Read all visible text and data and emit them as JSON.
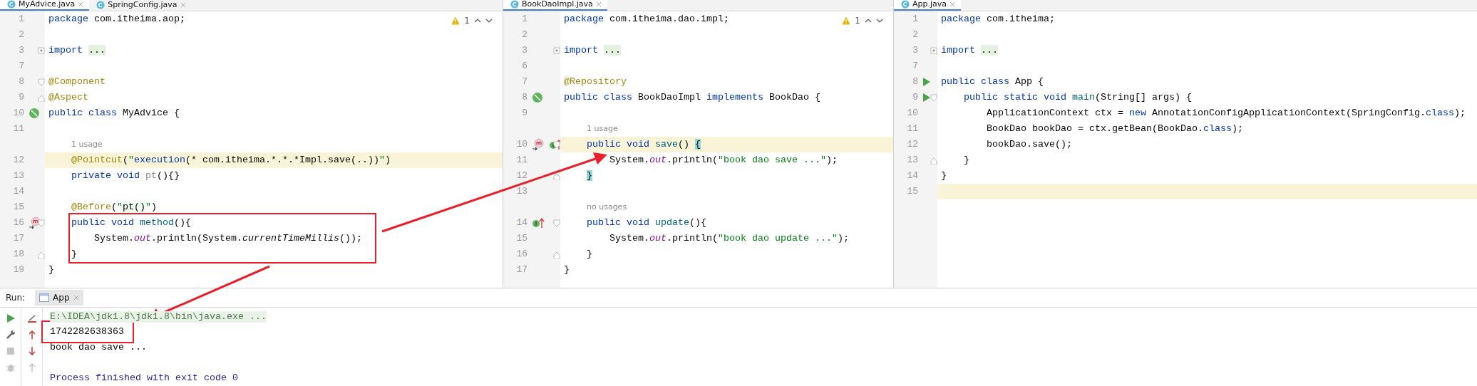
{
  "editors": [
    {
      "tabs": [
        {
          "label": "MyAdvice.java",
          "selected": true
        },
        {
          "label": "SpringConfig.java",
          "selected": false
        }
      ],
      "warning_count": "1",
      "lines": [
        {
          "kind": "code",
          "number": "1",
          "current": false,
          "tokens": [
            {
              "text": "package",
              "kind": "kw"
            },
            {
              "text": " com.itheima.aop;",
              "kind": "plain"
            }
          ]
        },
        {
          "kind": "code",
          "number": "2",
          "current": false
        },
        {
          "kind": "code",
          "number": "3",
          "current": false,
          "markers": [
            {
              "kind": "folded"
            }
          ],
          "tokens": [
            {
              "text": "import",
              "kind": "kw"
            },
            {
              "text": " ...",
              "kind": "folded"
            }
          ]
        },
        {
          "kind": "code",
          "number": "7",
          "current": false
        },
        {
          "kind": "code",
          "number": "8",
          "current": false,
          "markers": [
            {
              "kind": "foldstart"
            }
          ],
          "tokens": [
            {
              "text": "@Component",
              "kind": "ann"
            }
          ]
        },
        {
          "kind": "code",
          "number": "9",
          "current": false,
          "markers": [
            {
              "kind": "foldend"
            }
          ],
          "tokens": [
            {
              "text": "@Aspect",
              "kind": "ann"
            }
          ]
        },
        {
          "kind": "code",
          "number": "10",
          "current": false,
          "markers": [
            {
              "kind": "bean"
            }
          ],
          "tokens": [
            {
              "text": "public class",
              "kind": "kw"
            },
            {
              "text": " MyAdvice {",
              "kind": "plain"
            }
          ]
        },
        {
          "kind": "code",
          "number": "11",
          "current": false
        },
        {
          "kind": "hint",
          "text": "1 usage"
        },
        {
          "kind": "code",
          "number": "12",
          "current": true,
          "tokens": [
            {
              "text": "    @Pointcut",
              "kind": "ann"
            },
            {
              "text": "(",
              "kind": "plain"
            },
            {
              "text": "\"",
              "kind": "str"
            },
            {
              "text": "execution",
              "kind": "kw"
            },
            {
              "text": "(* com.itheima.*.*.*Impl.save(..))",
              "kind": "plain"
            },
            {
              "text": "\"",
              "kind": "str"
            },
            {
              "text": ")",
              "kind": "plain"
            }
          ]
        },
        {
          "kind": "code",
          "number": "13",
          "current": false,
          "tokens": [
            {
              "text": "    private void",
              "kind": "kw"
            },
            {
              "text": " pt",
              "kind": "unused"
            },
            {
              "text": "(){}",
              "kind": "plain"
            }
          ]
        },
        {
          "kind": "code",
          "number": "14",
          "current": false
        },
        {
          "kind": "code",
          "number": "15",
          "current": false,
          "tokens": [
            {
              "text": "    @Before",
              "kind": "ann"
            },
            {
              "text": "(",
              "kind": "plain"
            },
            {
              "text": "\"",
              "kind": "str"
            },
            {
              "text": "pt()",
              "kind": "inj"
            },
            {
              "text": "\"",
              "kind": "str"
            },
            {
              "text": ")",
              "kind": "plain"
            }
          ]
        },
        {
          "kind": "code",
          "number": "16",
          "current": false,
          "markers": [
            {
              "kind": "advice"
            },
            {
              "kind": "foldstart"
            }
          ],
          "tokens": [
            {
              "text": "    public void",
              "kind": "kw"
            },
            {
              "text": " method",
              "kind": "decl"
            },
            {
              "text": "(){",
              "kind": "plain"
            }
          ]
        },
        {
          "kind": "code",
          "number": "17",
          "current": false,
          "tokens": [
            {
              "text": "        System.",
              "kind": "plain"
            },
            {
              "text": "out",
              "kind": "field"
            },
            {
              "text": ".println(System.",
              "kind": "plain"
            },
            {
              "text": "currentTimeMillis",
              "kind": "static"
            },
            {
              "text": "());",
              "kind": "plain"
            }
          ]
        },
        {
          "kind": "code",
          "number": "18",
          "current": false,
          "markers": [
            {
              "kind": "foldend"
            }
          ],
          "tokens": [
            {
              "text": "    }",
              "kind": "plain"
            }
          ]
        },
        {
          "kind": "code",
          "number": "19",
          "current": false,
          "tokens": [
            {
              "text": "}",
              "kind": "plain"
            }
          ]
        }
      ]
    },
    {
      "tabs": [
        {
          "label": "BookDaoImpl.java",
          "selected": true
        }
      ],
      "warning_count": "1",
      "lines": [
        {
          "kind": "code",
          "number": "1",
          "current": false,
          "tokens": [
            {
              "text": "package",
              "kind": "kw"
            },
            {
              "text": " com.itheima.dao.impl;",
              "kind": "plain"
            }
          ]
        },
        {
          "kind": "code",
          "number": "2",
          "current": false
        },
        {
          "kind": "code",
          "number": "3",
          "current": false,
          "markers": [
            {
              "kind": "folded"
            }
          ],
          "tokens": [
            {
              "text": "import",
              "kind": "kw"
            },
            {
              "text": " ...",
              "kind": "folded"
            }
          ]
        },
        {
          "kind": "code",
          "number": "6",
          "current": false
        },
        {
          "kind": "code",
          "number": "7",
          "current": false,
          "tokens": [
            {
              "text": "@Repository",
              "kind": "ann"
            }
          ]
        },
        {
          "kind": "code",
          "number": "8",
          "current": false,
          "markers": [
            {
              "kind": "bean"
            }
          ],
          "tokens": [
            {
              "text": "public class",
              "kind": "kw"
            },
            {
              "text": " BookDaoImpl ",
              "kind": "plain"
            },
            {
              "text": "implements",
              "kind": "kw"
            },
            {
              "text": " BookDao {",
              "kind": "plain"
            }
          ]
        },
        {
          "kind": "code",
          "number": "9",
          "current": false
        },
        {
          "kind": "hint",
          "text": "1 usage"
        },
        {
          "kind": "code",
          "number": "10",
          "current": true,
          "markers": [
            {
              "kind": "advice"
            },
            {
              "kind": "implements"
            },
            {
              "kind": "foldstart"
            }
          ],
          "tokens": [
            {
              "text": "    public void",
              "kind": "kw"
            },
            {
              "text": " save",
              "kind": "decl"
            },
            {
              "text": "() ",
              "kind": "plain"
            },
            {
              "text": "{",
              "kind": "brace"
            }
          ]
        },
        {
          "kind": "code",
          "number": "11",
          "current": false,
          "tokens": [
            {
              "text": "        System.",
              "kind": "plain"
            },
            {
              "text": "out",
              "kind": "field"
            },
            {
              "text": ".println(",
              "kind": "plain"
            },
            {
              "text": "\"book dao save ...\"",
              "kind": "str"
            },
            {
              "text": ");",
              "kind": "plain"
            }
          ]
        },
        {
          "kind": "code",
          "number": "12",
          "current": false,
          "markers": [
            {
              "kind": "foldend"
            }
          ],
          "tokens": [
            {
              "text": "    }",
              "kind": "brace"
            }
          ]
        },
        {
          "kind": "code",
          "number": "13",
          "current": false
        },
        {
          "kind": "hint",
          "text": "no usages"
        },
        {
          "kind": "code",
          "number": "14",
          "current": false,
          "markers": [
            {
              "kind": "implements"
            },
            {
              "kind": "foldstart"
            }
          ],
          "tokens": [
            {
              "text": "    public void",
              "kind": "kw"
            },
            {
              "text": " update",
              "kind": "decl"
            },
            {
              "text": "(){",
              "kind": "plain"
            }
          ]
        },
        {
          "kind": "code",
          "number": "15",
          "current": false,
          "tokens": [
            {
              "text": "        System.",
              "kind": "plain"
            },
            {
              "text": "out",
              "kind": "field"
            },
            {
              "text": ".println(",
              "kind": "plain"
            },
            {
              "text": "\"book dao update ...\"",
              "kind": "str"
            },
            {
              "text": ");",
              "kind": "plain"
            }
          ]
        },
        {
          "kind": "code",
          "number": "16",
          "current": false,
          "markers": [
            {
              "kind": "foldend"
            }
          ],
          "tokens": [
            {
              "text": "    }",
              "kind": "plain"
            }
          ]
        },
        {
          "kind": "code",
          "number": "17",
          "current": false,
          "tokens": [
            {
              "text": "}",
              "kind": "plain"
            }
          ]
        }
      ]
    },
    {
      "tabs": [
        {
          "label": "App.java",
          "selected": true
        }
      ],
      "lines": [
        {
          "kind": "code",
          "number": "1",
          "current": false,
          "tokens": [
            {
              "text": "package",
              "kind": "kw"
            },
            {
              "text": " com.itheima;",
              "kind": "plain"
            }
          ]
        },
        {
          "kind": "code",
          "number": "2",
          "current": false
        },
        {
          "kind": "code",
          "number": "3",
          "current": false,
          "markers": [
            {
              "kind": "folded"
            }
          ],
          "tokens": [
            {
              "text": "import",
              "kind": "kw"
            },
            {
              "text": " ...",
              "kind": "folded"
            }
          ]
        },
        {
          "kind": "code",
          "number": "7",
          "current": false
        },
        {
          "kind": "code",
          "number": "8",
          "current": false,
          "markers": [
            {
              "kind": "run"
            }
          ],
          "tokens": [
            {
              "text": "public class",
              "kind": "kw"
            },
            {
              "text": " App {",
              "kind": "plain"
            }
          ]
        },
        {
          "kind": "code",
          "number": "9",
          "current": false,
          "markers": [
            {
              "kind": "run"
            },
            {
              "kind": "foldstart"
            }
          ],
          "tokens": [
            {
              "text": "    public static void",
              "kind": "kw"
            },
            {
              "text": " main",
              "kind": "decl"
            },
            {
              "text": "(String[] args) {",
              "kind": "plain"
            }
          ]
        },
        {
          "kind": "code",
          "number": "10",
          "current": false,
          "tokens": [
            {
              "text": "        ApplicationContext ctx = ",
              "kind": "plain"
            },
            {
              "text": "new",
              "kind": "kw"
            },
            {
              "text": " AnnotationConfigApplicationContext(SpringConfig.",
              "kind": "plain"
            },
            {
              "text": "class",
              "kind": "kw"
            },
            {
              "text": ");",
              "kind": "plain"
            }
          ]
        },
        {
          "kind": "code",
          "number": "11",
          "current": false,
          "tokens": [
            {
              "text": "        BookDao bookDao = ctx.getBean(BookDao.",
              "kind": "plain"
            },
            {
              "text": "class",
              "kind": "kw"
            },
            {
              "text": ");",
              "kind": "plain"
            }
          ]
        },
        {
          "kind": "code",
          "number": "12",
          "current": false,
          "tokens": [
            {
              "text": "        bookDao.save();",
              "kind": "plain"
            }
          ]
        },
        {
          "kind": "code",
          "number": "13",
          "current": false,
          "markers": [
            {
              "kind": "foldend"
            }
          ],
          "tokens": [
            {
              "text": "    }",
              "kind": "plain"
            }
          ]
        },
        {
          "kind": "code",
          "number": "14",
          "current": false,
          "tokens": [
            {
              "text": "}",
              "kind": "plain"
            }
          ]
        },
        {
          "kind": "code",
          "number": "15",
          "current": true
        }
      ]
    }
  ],
  "run_panel": {
    "label": "Run:",
    "tabs": [
      {
        "label": "App",
        "selected": true
      }
    ],
    "left_toolbar": [
      {
        "kind": "run",
        "disabled": false
      },
      {
        "kind": "wrench",
        "disabled": false
      },
      {
        "kind": "stop",
        "disabled": true
      },
      {
        "kind": "bug",
        "disabled": true
      }
    ],
    "right_toolbar": [
      {
        "kind": "clear",
        "disabled": false
      },
      {
        "kind": "up",
        "disabled": false
      },
      {
        "kind": "down",
        "disabled": false
      },
      {
        "kind": "up",
        "disabled": true
      }
    ],
    "console": [
      {
        "kind": "command",
        "text": "E:\\IDEA\\jdk1.8\\jdk1.8\\bin\\java.exe ..."
      },
      {
        "kind": "output",
        "text": "1742282638363"
      },
      {
        "kind": "output",
        "text": "book dao save ..."
      },
      {
        "kind": "system",
        "text": "Process finished with exit code 0"
      }
    ]
  }
}
